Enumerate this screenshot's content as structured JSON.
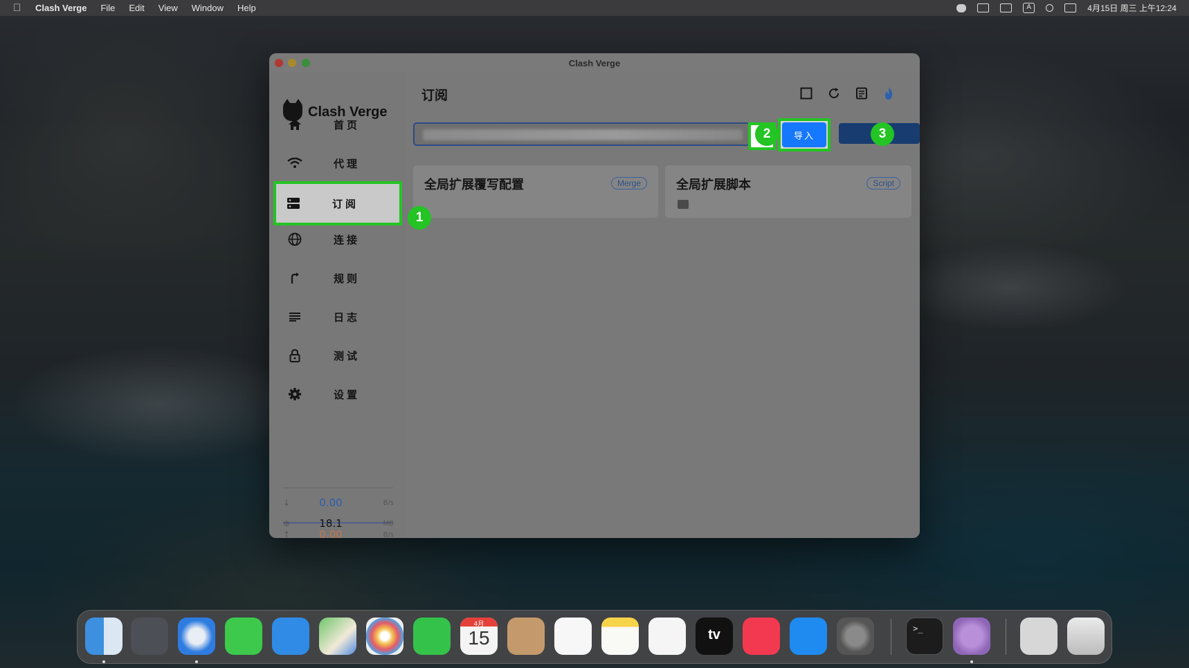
{
  "menubar": {
    "app_name": "Clash Verge",
    "items": [
      "File",
      "Edit",
      "View",
      "Window",
      "Help"
    ],
    "clock": "4月15日 周三 上午12:24",
    "input_indicator": "A"
  },
  "window": {
    "title": "Clash Verge"
  },
  "sidebar": {
    "logo_text": "Clash Verge",
    "items": [
      {
        "label": "首页",
        "icon": "home-icon"
      },
      {
        "label": "代理",
        "icon": "wifi-icon"
      },
      {
        "label": "订阅",
        "icon": "server-icon",
        "active": true
      },
      {
        "label": "连接",
        "icon": "globe-icon"
      },
      {
        "label": "规则",
        "icon": "fork-icon"
      },
      {
        "label": "日志",
        "icon": "list-icon"
      },
      {
        "label": "测试",
        "icon": "lock-icon"
      },
      {
        "label": "设置",
        "icon": "gear-icon"
      }
    ],
    "traffic": {
      "upload": {
        "value": "0.00",
        "unit": "B/s",
        "color": "#c0794f"
      },
      "download": {
        "value": "0.00",
        "unit": "B/s",
        "color": "#2b5fb0"
      },
      "memory": {
        "value": "18.1",
        "unit": "MB"
      }
    }
  },
  "main": {
    "title": "订阅",
    "import_label": "导入",
    "clear_symbol": "×",
    "cards": [
      {
        "title": "全局扩展覆写配置",
        "tag": "Merge"
      },
      {
        "title": "全局扩展脚本",
        "tag": "Script"
      }
    ]
  },
  "annotations": [
    "1",
    "2",
    "3"
  ],
  "dock": {
    "calendar_month": "4月",
    "calendar_day": "15",
    "tv_label": "tv",
    "terminal_prompt": ">_"
  },
  "colors": {
    "highlight": "#23c423",
    "import_button": "#1677ff"
  }
}
